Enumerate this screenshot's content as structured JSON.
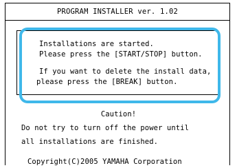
{
  "title": "PROGRAM INSTALLER ver. 1.02",
  "message": {
    "line1": "Installations are started.",
    "line2": "Please press the [START/STOP] button.",
    "line3": "If you want to delete the install data,",
    "line4": "please press the [BREAK] button."
  },
  "caution": {
    "heading": "Caution!",
    "line1": "Do not try to turn off the power until",
    "line2": "all installations are finished."
  },
  "copyright": "Copyright(C)2005 YAMAHA Corporation",
  "colors": {
    "highlight": "#3fb8ea",
    "border": "#000000",
    "background": "#ffffff"
  }
}
